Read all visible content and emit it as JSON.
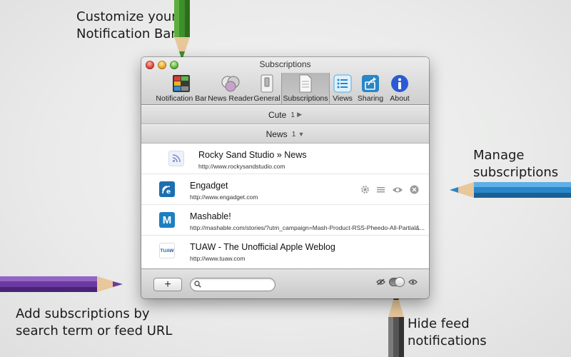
{
  "callouts": {
    "notification_bar": "Customize your\nNotification Bar",
    "manage": "Manage\nsubscriptions",
    "add": "Add subscriptions by\nsearch term or feed URL",
    "hide": "Hide feed\nnotifications"
  },
  "window": {
    "title": "Subscriptions",
    "toolbar": [
      {
        "label": "Notification Bar",
        "icon": "notification-bar-icon"
      },
      {
        "label": "News Reader",
        "icon": "news-reader-icon"
      },
      {
        "label": "General",
        "icon": "general-switch-icon"
      },
      {
        "label": "Subscriptions",
        "icon": "subscriptions-document-icon",
        "selected": true
      },
      {
        "label": "Views",
        "icon": "views-list-icon"
      },
      {
        "label": "Sharing",
        "icon": "sharing-arrow-icon"
      },
      {
        "label": "About",
        "icon": "about-info-icon"
      }
    ]
  },
  "groups": [
    {
      "name": "Cute",
      "count": "1",
      "state": "collapsed"
    },
    {
      "name": "News",
      "count": "1",
      "state": "expanded"
    }
  ],
  "feeds": [
    {
      "name": "Rocky Sand Studio » News",
      "url": "http://www.rockysandstudio.com",
      "icon": "rss-feed-icon"
    },
    {
      "name": "Engadget",
      "url": "http://www.engadget.com",
      "icon": "engadget-icon"
    },
    {
      "name": "Mashable!",
      "url": "http://mashable.com/stories/?utm_campaign=Mash-Product-RSS-Pheedo-All-Partial&...",
      "icon": "mashable-icon",
      "icon_text": "M"
    },
    {
      "name": "TUAW - The Unofficial Apple Weblog",
      "url": "http://www.tuaw.com",
      "icon": "tuaw-icon",
      "icon_text": "TUAW"
    }
  ],
  "bottom": {
    "add_label": "+",
    "search_placeholder": "",
    "search_value": ""
  },
  "colors": {
    "pencil_green": "#3f8f2a",
    "pencil_blue": "#2a86c8",
    "pencil_purple": "#6a3aa0",
    "pencil_gray": "#555555",
    "mashable_blue": "#1e7fc0",
    "engadget_blue": "#1c6fb0"
  }
}
